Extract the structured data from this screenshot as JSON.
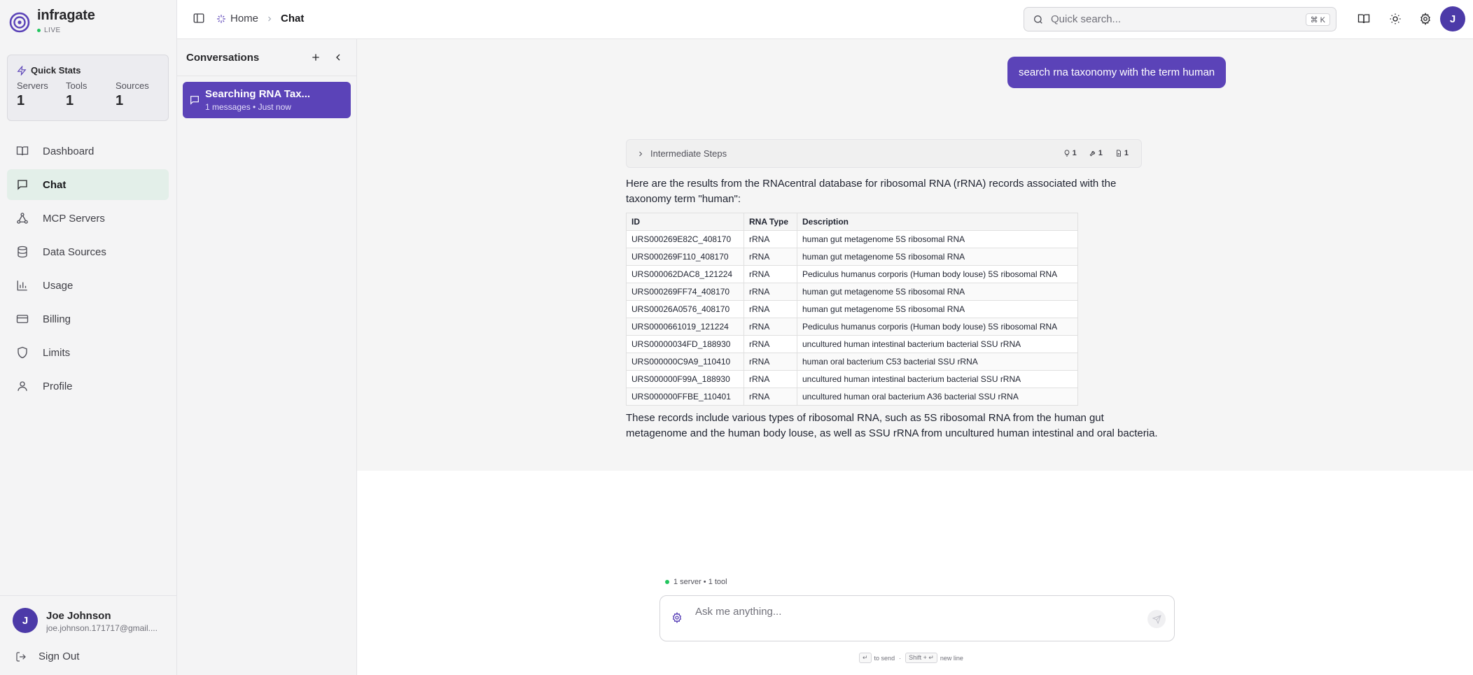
{
  "brand": {
    "name": "infragate",
    "status": "LIVE"
  },
  "quick_stats": {
    "title": "Quick Stats",
    "stats": [
      {
        "label": "Servers",
        "value": "1"
      },
      {
        "label": "Tools",
        "value": "1"
      },
      {
        "label": "Sources",
        "value": "1"
      }
    ]
  },
  "nav": {
    "items": [
      {
        "label": "Dashboard",
        "icon": "book-icon"
      },
      {
        "label": "Chat",
        "icon": "chat-icon",
        "active": true
      },
      {
        "label": "MCP Servers",
        "icon": "network-icon"
      },
      {
        "label": "Data Sources",
        "icon": "database-icon"
      },
      {
        "label": "Usage",
        "icon": "bar-chart-icon"
      },
      {
        "label": "Billing",
        "icon": "credit-card-icon"
      },
      {
        "label": "Limits",
        "icon": "shield-icon"
      },
      {
        "label": "Profile",
        "icon": "user-icon"
      }
    ]
  },
  "user": {
    "initial": "J",
    "name": "Joe Johnson",
    "email": "joe.johnson.171717@gmail....",
    "sign_out": "Sign Out"
  },
  "header": {
    "breadcrumb_home": "Home",
    "breadcrumb_current": "Chat",
    "search_placeholder": "Quick search...",
    "search_shortcut": "⌘ K",
    "avatar_initial": "J"
  },
  "conversations": {
    "title": "Conversations",
    "items": [
      {
        "title": "Searching RNA Tax...",
        "meta": "1 messages • Just now"
      }
    ]
  },
  "chat": {
    "user_message": "search rna taxonomy with the term human",
    "steps": {
      "label": "Intermediate Steps",
      "badges": [
        "1",
        "1",
        "1"
      ]
    },
    "intro": "Here are the results from the RNAcentral database for ribosomal RNA (rRNA) records associated with the taxonomy term \"human\":",
    "table": {
      "headers": [
        "ID",
        "RNA Type",
        "Description"
      ],
      "rows": [
        [
          "URS000269E82C_408170",
          "rRNA",
          "human gut metagenome 5S ribosomal RNA"
        ],
        [
          "URS000269F110_408170",
          "rRNA",
          "human gut metagenome 5S ribosomal RNA"
        ],
        [
          "URS000062DAC8_121224",
          "rRNA",
          "Pediculus humanus corporis (Human body louse) 5S ribosomal RNA"
        ],
        [
          "URS000269FF74_408170",
          "rRNA",
          "human gut metagenome 5S ribosomal RNA"
        ],
        [
          "URS00026A0576_408170",
          "rRNA",
          "human gut metagenome 5S ribosomal RNA"
        ],
        [
          "URS0000661019_121224",
          "rRNA",
          "Pediculus humanus corporis (Human body louse) 5S ribosomal RNA"
        ],
        [
          "URS00000034FD_188930",
          "rRNA",
          "uncultured human intestinal bacterium bacterial SSU rRNA"
        ],
        [
          "URS000000C9A9_110410",
          "rRNA",
          "human oral bacterium C53 bacterial SSU rRNA"
        ],
        [
          "URS000000F99A_188930",
          "rRNA",
          "uncultured human intestinal bacterium bacterial SSU rRNA"
        ],
        [
          "URS000000FFBE_110401",
          "rRNA",
          "uncultured human oral bacterium A36 bacterial SSU rRNA"
        ]
      ]
    },
    "outro": "These records include various types of ribosomal RNA, such as 5S ribosomal RNA from the human gut metagenome and the human body louse, as well as SSU rRNA from uncultured human intestinal and oral bacteria."
  },
  "composer": {
    "status": "1 server • 1 tool",
    "placeholder": "Ask me anything...",
    "hint_send_key": "↵",
    "hint_send": "to send",
    "hint_newline_key": "Shift + ↵",
    "hint_newline": "new line"
  },
  "colors": {
    "accent": "#5b43b8",
    "active_nav": "#e3efe9",
    "live": "#22c55e"
  }
}
